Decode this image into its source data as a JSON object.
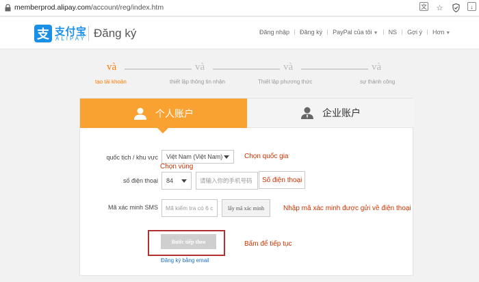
{
  "browser": {
    "url_host": "memberprod.alipay.com",
    "url_path": "/account/reg/index.htm",
    "icons": [
      "translate-icon",
      "star-icon",
      "shield-icon",
      "download-icon"
    ]
  },
  "header": {
    "logo_mark": "支",
    "logo_cn": "支付宝",
    "logo_en": "ALIPAY",
    "page_title": "Đăng ký",
    "nav": {
      "login": "Đăng nhập",
      "register": "Đăng ký",
      "paypal": "PayPal của tôi",
      "ns": "NS",
      "suggest": "Gợi ý",
      "more": "Hơn"
    }
  },
  "steps": [
    {
      "icon": "và",
      "label": "tạo tài khoản",
      "active": true
    },
    {
      "icon": "và",
      "label": "thiết lập thông tin nhận",
      "active": false
    },
    {
      "icon": "và",
      "label": "Thiết lập phương thức",
      "active": false
    },
    {
      "icon": "và",
      "label": "sự thành công",
      "active": false
    }
  ],
  "tabs": {
    "personal": "个人账户",
    "business": "企业账户"
  },
  "form": {
    "nationality_label": "quốc tịch / khu vực",
    "nationality_value": "Việt Nam (Việt Nam)",
    "phone_label": "số điện thoại",
    "phone_code": "84",
    "phone_placeholder": "请输入你的手机号码",
    "sms_label": "Mã xác minh SMS",
    "sms_placeholder": "Mã kiểm tra có 6 c",
    "sms_button": "lấy mã xác minh",
    "next_button": "Bước tiếp theo",
    "email_link": "Đăng ký bằng email"
  },
  "annotations": {
    "choose_country": "Chọn quốc gia",
    "choose_region": "Chọn vùng",
    "phone_number": "Số điện thoại",
    "enter_code": "Nhập mã xác minh được gửi về điện thoại",
    "click_continue": "Bấm để tiếp tục"
  },
  "colors": {
    "accent": "#f9a231",
    "brand_blue": "#1a8fe6",
    "annotation": "#cc3300",
    "highlight_box": "#b03030"
  }
}
